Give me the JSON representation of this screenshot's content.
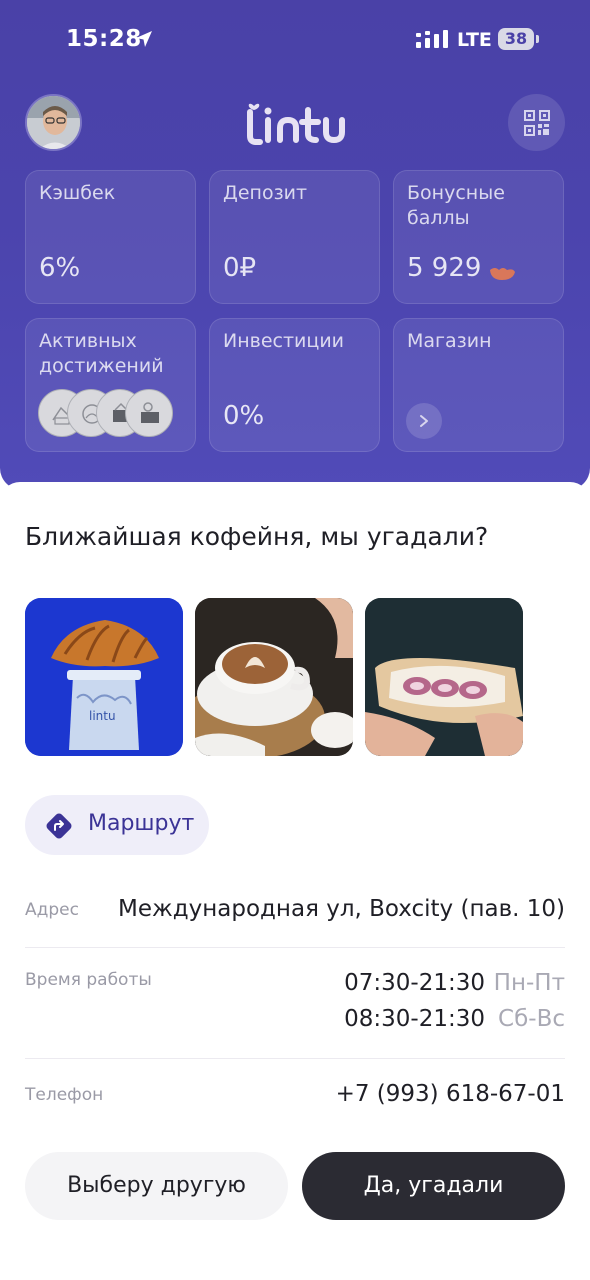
{
  "status_bar": {
    "time": "15:28",
    "network": "LTE",
    "battery": "38"
  },
  "header": {
    "brand": "lintu"
  },
  "cards": [
    {
      "label": "Кэшбек",
      "value": "6%"
    },
    {
      "label": "Депозит",
      "value": "0₽"
    },
    {
      "label": "Бонусные баллы",
      "value": "5 929"
    },
    {
      "label": "Активных достижений"
    },
    {
      "label": "Инвестиции",
      "value": "0%"
    },
    {
      "label": "Магазин"
    }
  ],
  "sheet": {
    "title": "Ближайшая кофейня, мы угадали?",
    "route_label": "Маршрут",
    "address": {
      "label": "Адрес",
      "value": "Международная ул, Boxcity (пав. 10)"
    },
    "hours": {
      "label": "Время работы",
      "rows": [
        {
          "time": "07:30-21:30",
          "days": "Пн-Пт"
        },
        {
          "time": "08:30-21:30",
          "days": "Сб-Вс"
        }
      ]
    },
    "phone": {
      "label": "Телефон",
      "value": "+7 (993) 618-67-01"
    },
    "buttons": {
      "other": "Выберу другую",
      "confirm": "Да, угадали"
    }
  },
  "colors": {
    "header_bg": "#4a41a7",
    "accent": "#3b3396",
    "dark_button": "#2b2b33",
    "bonus_icon": "#d9775a"
  },
  "icons": [
    "location-arrow-icon",
    "signal-icon",
    "qr-code-icon",
    "bonus-coin-icon",
    "chevron-right-icon",
    "route-icon"
  ]
}
